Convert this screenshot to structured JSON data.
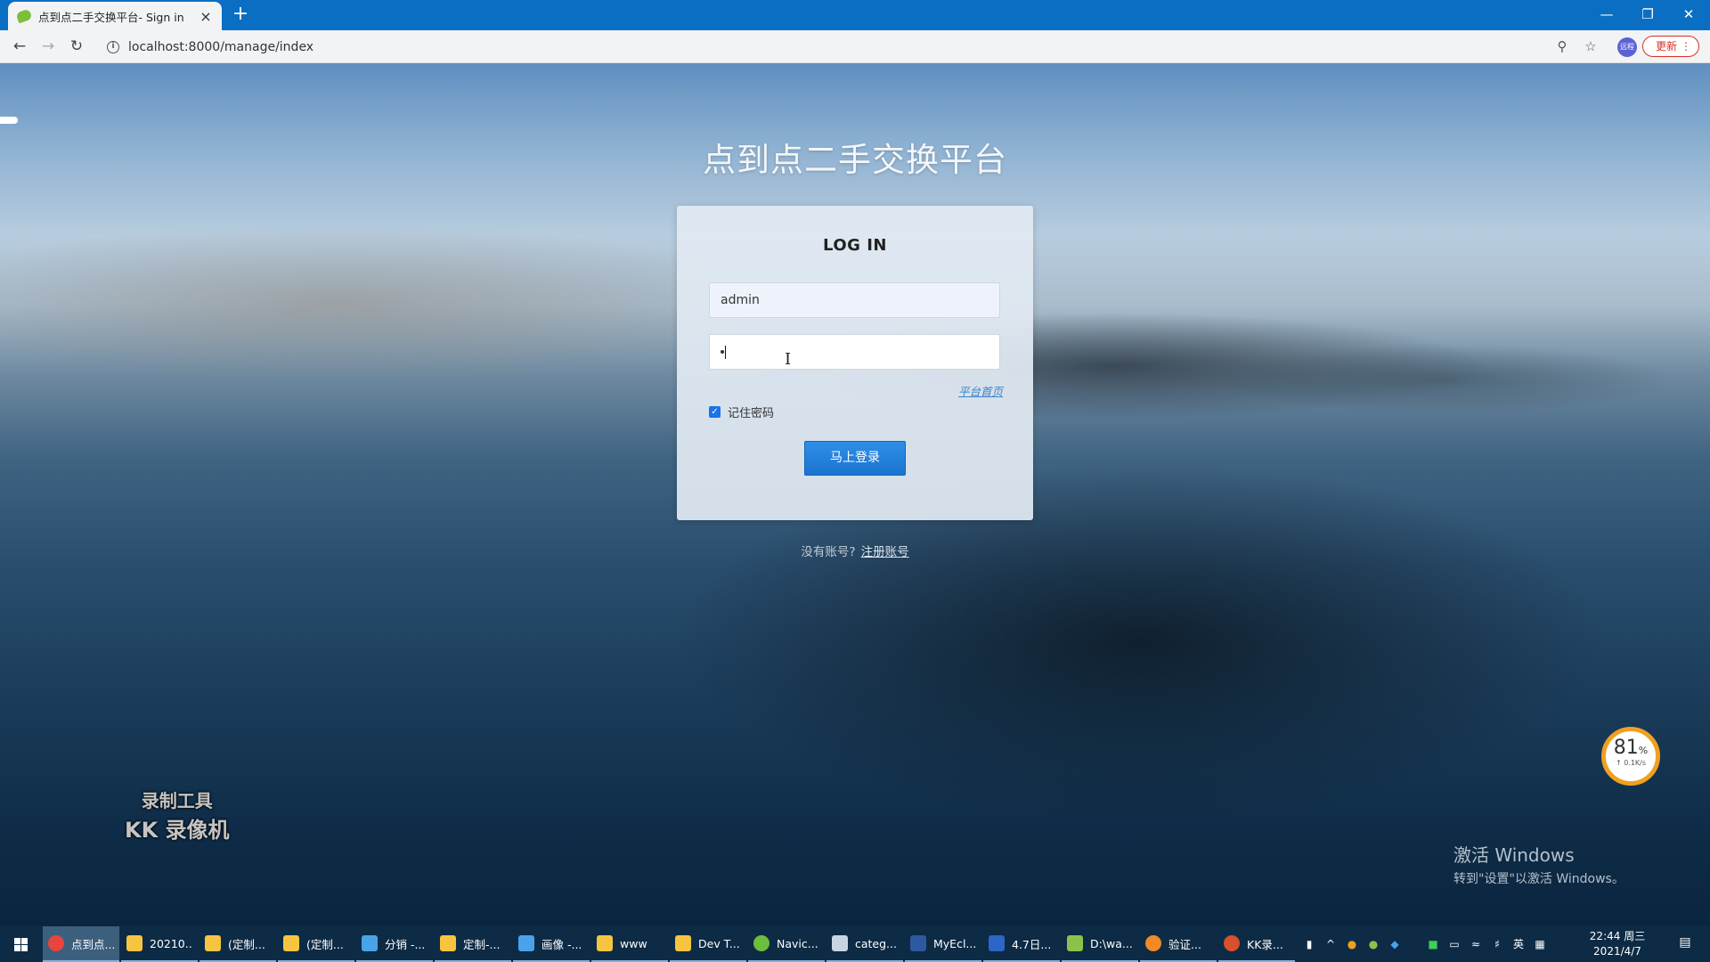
{
  "browser": {
    "tab_title": "点到点二手交换平台- Sign in",
    "tab_close": "×",
    "new_tab": "+",
    "url": "localhost:8000/manage/index",
    "profile_label": "远程",
    "update_label": "更新"
  },
  "page": {
    "site_title": "点到点二手交换平台",
    "login": {
      "heading": "LOG IN",
      "username_value": "admin",
      "home_link": "平台首页",
      "remember_label": "记住密码",
      "remember_checked": true,
      "submit_label": "马上登录"
    },
    "signup_prompt": "没有账号?",
    "signup_link": "注册账号"
  },
  "overlays": {
    "recorder_line1": "录制工具",
    "recorder_line2": "KK 录像机",
    "activate_line1": "激活 Windows",
    "activate_line2": "转到\"设置\"以激活 Windows。",
    "net_percent": "81",
    "net_percent_unit": "%",
    "net_speed": "↑ 0.1K/s"
  },
  "taskbar": {
    "items": [
      {
        "label": "点到点...",
        "icon": "chrome-icon",
        "color": "#e8453c"
      },
      {
        "label": "20210...",
        "icon": "folder-icon",
        "color": "#f5c542"
      },
      {
        "label": "(定制...",
        "icon": "folder-icon",
        "color": "#f5c542"
      },
      {
        "label": "(定制...",
        "icon": "folder-icon",
        "color": "#f5c542"
      },
      {
        "label": "分销 -...",
        "icon": "app-icon",
        "color": "#4aa3e8"
      },
      {
        "label": "定制-...",
        "icon": "folder-icon",
        "color": "#f5c542"
      },
      {
        "label": "画像 -...",
        "icon": "app-icon",
        "color": "#4aa3e8"
      },
      {
        "label": "www",
        "icon": "folder-icon",
        "color": "#f5c542"
      },
      {
        "label": "Dev T...",
        "icon": "folder-icon",
        "color": "#f5c542"
      },
      {
        "label": "Navic...",
        "icon": "navicat-icon",
        "color": "#6cbf3a"
      },
      {
        "label": "categ...",
        "icon": "window-icon",
        "color": "#c8d4e0"
      },
      {
        "label": "MyEcl...",
        "icon": "myeclipse-icon",
        "color": "#2b5aa0"
      },
      {
        "label": "4.7日...",
        "icon": "word-icon",
        "color": "#2b66c8"
      },
      {
        "label": "D:\\wa...",
        "icon": "notepad-icon",
        "color": "#8bc34a"
      },
      {
        "label": "验证...",
        "icon": "audio-icon",
        "color": "#f08a24"
      },
      {
        "label": "KK录...",
        "icon": "kk-recorder-icon",
        "color": "#d8502c"
      }
    ],
    "tray": {
      "ime": "英",
      "time": "22:44 周三",
      "date": "2021/4/7"
    }
  }
}
